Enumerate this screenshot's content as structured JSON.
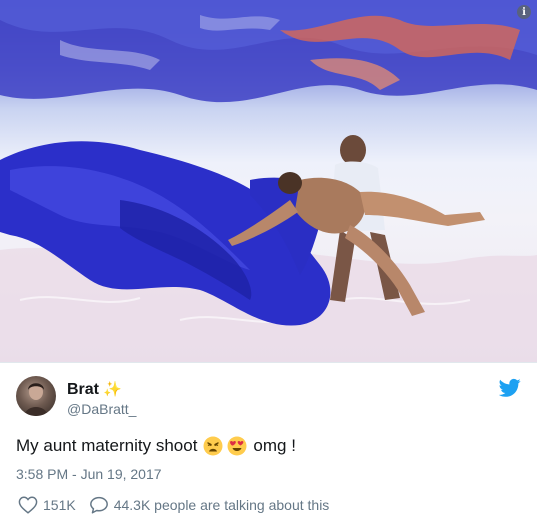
{
  "photo": {
    "alt": "Underwater maternity photo",
    "accent_fabric": "#2b2fc9"
  },
  "author": {
    "name": "Brat",
    "badge": "✨",
    "handle": "@DaBratt_"
  },
  "tweet": {
    "text_before": "My aunt maternity shoot",
    "emojis": [
      "weary-face-emoji",
      "heart-eyes-emoji"
    ],
    "text_after": "omg !",
    "timestamp": "3:58 PM - Jun 19, 2017"
  },
  "actions": {
    "likes": "151K",
    "replies_text": "44.3K people are talking about this"
  },
  "colors": {
    "twitter_blue": "#1da1f2",
    "secondary_text": "#657786"
  }
}
